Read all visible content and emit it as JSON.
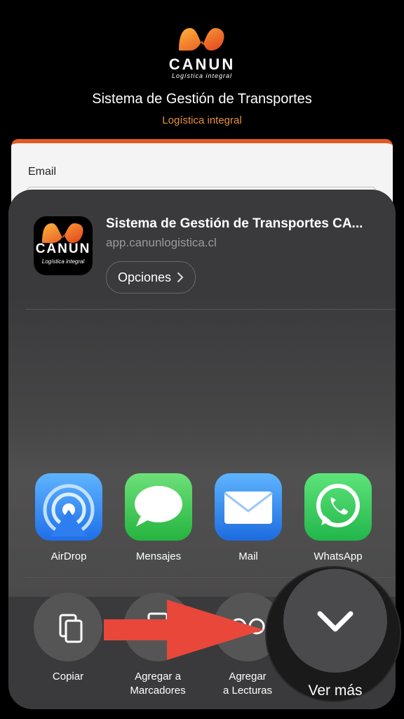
{
  "background": {
    "logo": {
      "word": "CANUN",
      "sub": "Logística integral"
    },
    "title": "Sistema de Gestión de Transportes",
    "subtitle": "Logística integral",
    "email_label": "Email",
    "colors": {
      "accent": "#e8913a",
      "card_border": "#e25a23"
    }
  },
  "share_sheet": {
    "app_icon": {
      "word": "CANUN",
      "sub": "Logística integral"
    },
    "title": "Sistema de Gestión de Transportes CA...",
    "url": "app.canunlogistica.cl",
    "options_label": "Opciones",
    "options_icon": "chevron-right-icon",
    "apps": [
      {
        "label": "AirDrop",
        "icon": "airdrop-icon",
        "color": "#2f8cff"
      },
      {
        "label": "Mensajes",
        "icon": "messages-icon",
        "color": "#34c759"
      },
      {
        "label": "Mail",
        "icon": "mail-icon",
        "color": "#2f8cff"
      },
      {
        "label": "WhatsApp",
        "icon": "whatsapp-icon",
        "color": "#25d366"
      }
    ],
    "actions": [
      {
        "label": "Copiar",
        "icon": "copy-icon"
      },
      {
        "label1": "Agregar a",
        "label2": "Marcadores",
        "icon": "bookmark-icon"
      },
      {
        "label1": "Agregar",
        "label2": "a Lecturas",
        "icon": "reading-list-icon"
      }
    ],
    "more": {
      "label": "Ver más",
      "icon": "chevron-down-icon"
    }
  },
  "annotation": {
    "arrow_color": "#e8473a"
  }
}
